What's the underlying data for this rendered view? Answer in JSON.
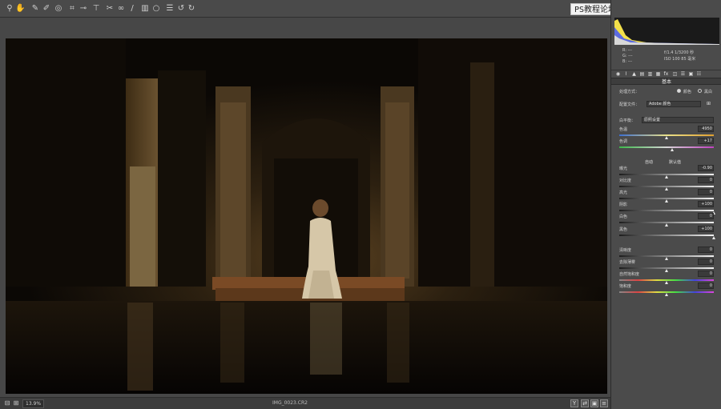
{
  "toolbar": {
    "tools": [
      {
        "icon": "zoom-icon",
        "glyph": "⚲"
      },
      {
        "icon": "hand-icon",
        "glyph": "✋"
      },
      {
        "icon": "white-balance-icon",
        "glyph": "✎"
      },
      {
        "icon": "color-sampler-icon",
        "glyph": "✐"
      },
      {
        "icon": "targeted-adjustment-icon",
        "glyph": "◎"
      },
      {
        "icon": "crop-icon",
        "glyph": "⌗"
      },
      {
        "icon": "straighten-icon",
        "glyph": "⊸"
      },
      {
        "icon": "transform-icon",
        "glyph": "⊤"
      },
      {
        "icon": "spot-removal-icon",
        "glyph": "✂"
      },
      {
        "icon": "red-eye-icon",
        "glyph": "∞"
      },
      {
        "icon": "adjustment-brush-icon",
        "glyph": "/"
      },
      {
        "icon": "graduated-filter-icon",
        "glyph": "▥"
      },
      {
        "icon": "radial-filter-icon",
        "glyph": "○"
      },
      {
        "icon": "preferences-icon",
        "glyph": "☰"
      },
      {
        "icon": "rotate-left-icon",
        "glyph": "↺"
      },
      {
        "icon": "rotate-right-icon",
        "glyph": "↻"
      }
    ],
    "watermark": "PS教程论坛 www.16XX8.COM"
  },
  "statusbar": {
    "zoom": "13.9%",
    "filename": "IMG_0023.CR2"
  },
  "panel": {
    "info": {
      "r": "R: ---",
      "g": "G: ---",
      "b": "B: ---",
      "exposure": "f/1.4  1/3200 秒",
      "iso": "ISO 100   85 毫米"
    },
    "section_title": "基本",
    "treatment_label": "处理方式：",
    "color_option": "颜色",
    "bw_option": "黑白",
    "profile_label": "配置文件：",
    "profile_value": "Adobe 颜色",
    "wb_label": "白平衡：",
    "wb_value": "原照设置",
    "auto_label": "自动",
    "default_label": "默认值",
    "sliders": [
      {
        "label": "色温",
        "value": "4950",
        "level": 0.5
      },
      {
        "label": "色调",
        "value": "+17",
        "level": 0.56
      },
      {
        "label": "曝光",
        "value": "-0.90",
        "level": 0.5
      },
      {
        "label": "对比度",
        "value": "0",
        "level": 0.5
      },
      {
        "label": "高光",
        "value": "0",
        "level": 0.5
      },
      {
        "label": "阴影",
        "value": "+100",
        "level": 1.0
      },
      {
        "label": "白色",
        "value": "0",
        "level": 0.5
      },
      {
        "label": "黑色",
        "value": "+100",
        "level": 1.0
      },
      {
        "label": "清晰度",
        "value": "0",
        "level": 0.5
      },
      {
        "label": "去除薄雾",
        "value": "0",
        "level": 0.5
      },
      {
        "label": "自然饱和度",
        "value": "0",
        "level": 0.5
      },
      {
        "label": "饱和度",
        "value": "0",
        "level": 0.5
      }
    ]
  },
  "colors": {
    "accent": "#e8e8e8",
    "panel_bg": "#4b4b4b",
    "canvas_bg": "#474747"
  }
}
